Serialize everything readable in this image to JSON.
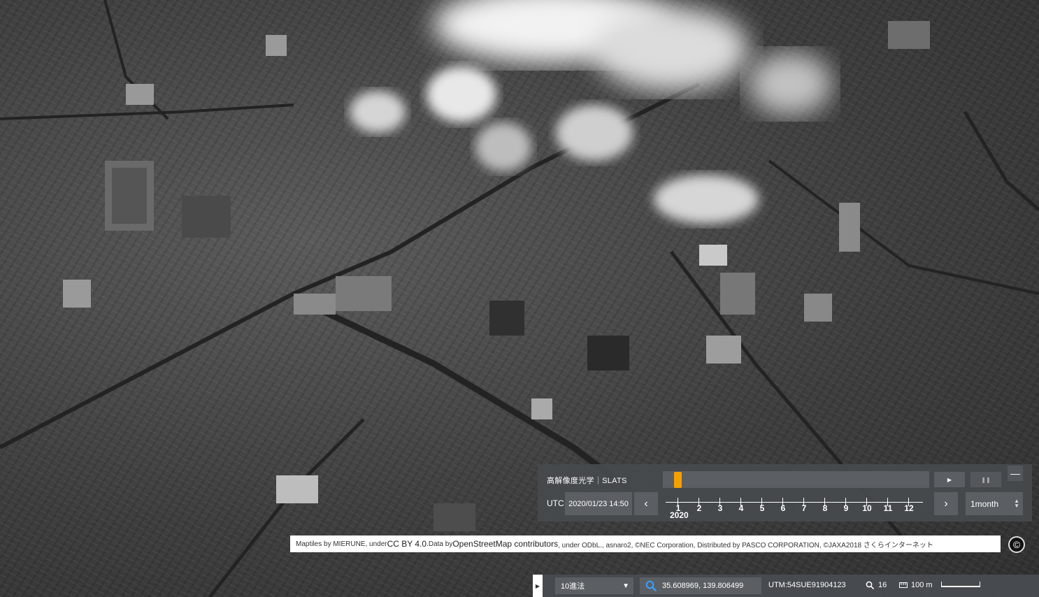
{
  "time_panel": {
    "satellite_label": "高解像度光学｜SLATS",
    "utc_label": "UTC",
    "utc_value": "2020/01/23 14:50",
    "months": [
      "1",
      "2",
      "3",
      "4",
      "5",
      "6",
      "7",
      "8",
      "9",
      "10",
      "11",
      "12"
    ],
    "year": "2020",
    "step_value": "1month",
    "handle_color": "#f5a000"
  },
  "attribution": {
    "part1": "Maptiles by MIERUNE, under ",
    "cc_link": "CC BY 4.0",
    "part2": ".Data by ",
    "osm_link": "OpenStreetMap contributors",
    "part3": ", under ODbL., asnaro2, ©NEC Corporation, Distributed by PASCO CORPORATION, ©JAXA2018 さくらインターネット"
  },
  "status_bar": {
    "format": "10進法",
    "coordinates": "35.608969, 139.806499",
    "utm": "UTM:54SUE91904123",
    "zoom": "16",
    "scale": "100 m"
  },
  "icons": {
    "play": "play-icon",
    "pause": "pause-icon",
    "collapse": "minus-icon",
    "prev": "chevron-left-icon",
    "next": "chevron-right-icon",
    "search": "search-icon",
    "zoom": "magnifier-icon",
    "ruler": "ruler-icon",
    "copyright": "copyright-icon"
  }
}
